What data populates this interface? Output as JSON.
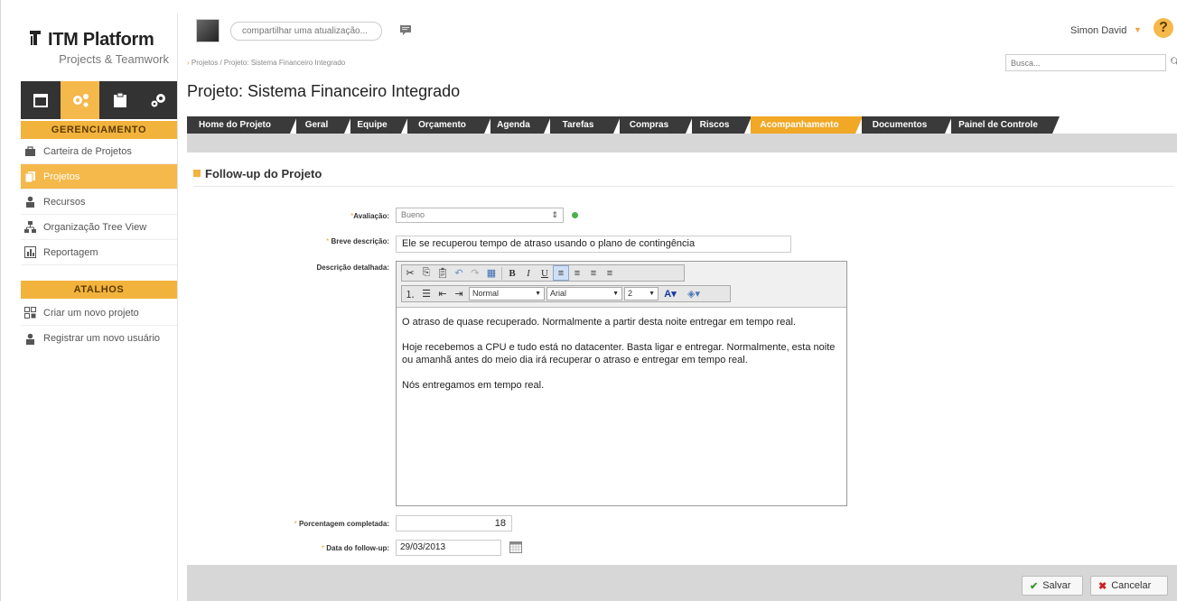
{
  "brand": {
    "title": "ITM Platform",
    "subtitle": "Projects & Teamwork"
  },
  "sidebar": {
    "modules": [
      {
        "name": "calendar-icon"
      },
      {
        "name": "gears-icon",
        "active": true
      },
      {
        "name": "clipboard-icon"
      },
      {
        "name": "cog-icon"
      }
    ],
    "section_management": "GERENCIAMENTO",
    "items": [
      {
        "label": "Carteira de Projetos",
        "icon": "briefcase-icon"
      },
      {
        "label": "Projetos",
        "icon": "documents-icon",
        "active": true
      },
      {
        "label": "Recursos",
        "icon": "person-icon"
      },
      {
        "label": "Organização Tree View",
        "icon": "org-tree-icon"
      },
      {
        "label": "Reportagem",
        "icon": "report-icon"
      }
    ],
    "section_shortcuts": "ATALHOS",
    "shortcuts": [
      {
        "label": "Criar um novo projeto",
        "icon": "new-project-icon"
      },
      {
        "label": "Registrar um novo usuário",
        "icon": "person-icon"
      }
    ]
  },
  "topbar": {
    "share_placeholder": "compartilhar uma atualização...",
    "user_name": "Simon David",
    "help": "?"
  },
  "breadcrumb": "Projetos / Projeto: Sistema Financeiro Integrado",
  "search": {
    "placeholder": "Busca..."
  },
  "page_title": "Projeto: Sistema Financeiro Integrado",
  "tabs": [
    {
      "label": "Home do Projeto"
    },
    {
      "label": "Geral"
    },
    {
      "label": "Equipe"
    },
    {
      "label": "Orçamento"
    },
    {
      "label": "Agenda"
    },
    {
      "label": "Tarefas"
    },
    {
      "label": "Compras"
    },
    {
      "label": "Riscos"
    },
    {
      "label": "Acompanhamento",
      "active": true
    },
    {
      "label": "Documentos"
    },
    {
      "label": "Painel de Controle"
    }
  ],
  "form": {
    "section_title": "Follow-up do Projeto",
    "evaluation_label": "Avaliação:",
    "evaluation_value": "Bueno",
    "evaluation_status_color": "#4cb04c",
    "short_desc_label": "Breve descrição:",
    "short_desc_value": "Ele se recuperou tempo de atraso usando o plano de contingência",
    "detailed_desc_label": "Descrição detalhada:",
    "editor": {
      "format_value": "Normal",
      "font_value": "Arial",
      "size_value": "2",
      "paragraphs": [
        "O atraso de quase recuperado. Normalmente a partir desta noite entregar em tempo real.",
        "Hoje recebemos a CPU e tudo está no datacenter. Basta ligar e entregar. Normalmente, esta noite ou amanhã antes do meio dia irá recuperar o atraso e entregar em tempo real.",
        "Nós entregamos em tempo real."
      ]
    },
    "percent_label": "Porcentagem completada:",
    "percent_value": "18",
    "date_label": "Data do follow-up:",
    "date_value": "29/03/2013"
  },
  "actions": {
    "save": "Salvar",
    "cancel": "Cancelar"
  }
}
